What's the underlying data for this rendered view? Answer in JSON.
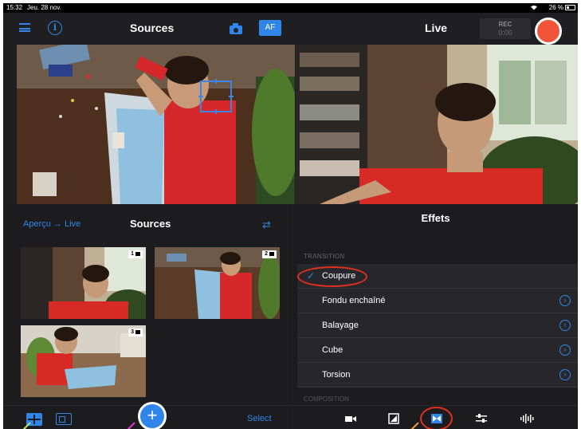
{
  "status_bar": {
    "time": "15:32",
    "date": "Jeu. 28 nov.",
    "battery": "26 %"
  },
  "nav": {
    "left_title": "Sources",
    "af_label": "AF",
    "right_title": "Live",
    "rec_label": "REC",
    "rec_time": "0:00"
  },
  "sources_panel": {
    "link": "Aperçu → Live",
    "title": "Sources",
    "thumbnails": [
      {
        "badge": "1"
      },
      {
        "badge": "2"
      },
      {
        "badge": "3"
      }
    ]
  },
  "effects_panel": {
    "title": "Effets",
    "section": "TRANSITION",
    "items": [
      {
        "label": "Coupure",
        "selected": true
      },
      {
        "label": "Fondu enchaîné",
        "selected": false
      },
      {
        "label": "Balayage",
        "selected": false
      },
      {
        "label": "Cube",
        "selected": false
      },
      {
        "label": "Torsion",
        "selected": false
      }
    ],
    "next_section": "COMPOSITION"
  },
  "bottom_bar": {
    "select_label": "Select",
    "add_label": "+"
  },
  "colors": {
    "accent": "#2f86e8",
    "record": "#f2543a",
    "annotation": "#e0301f"
  }
}
